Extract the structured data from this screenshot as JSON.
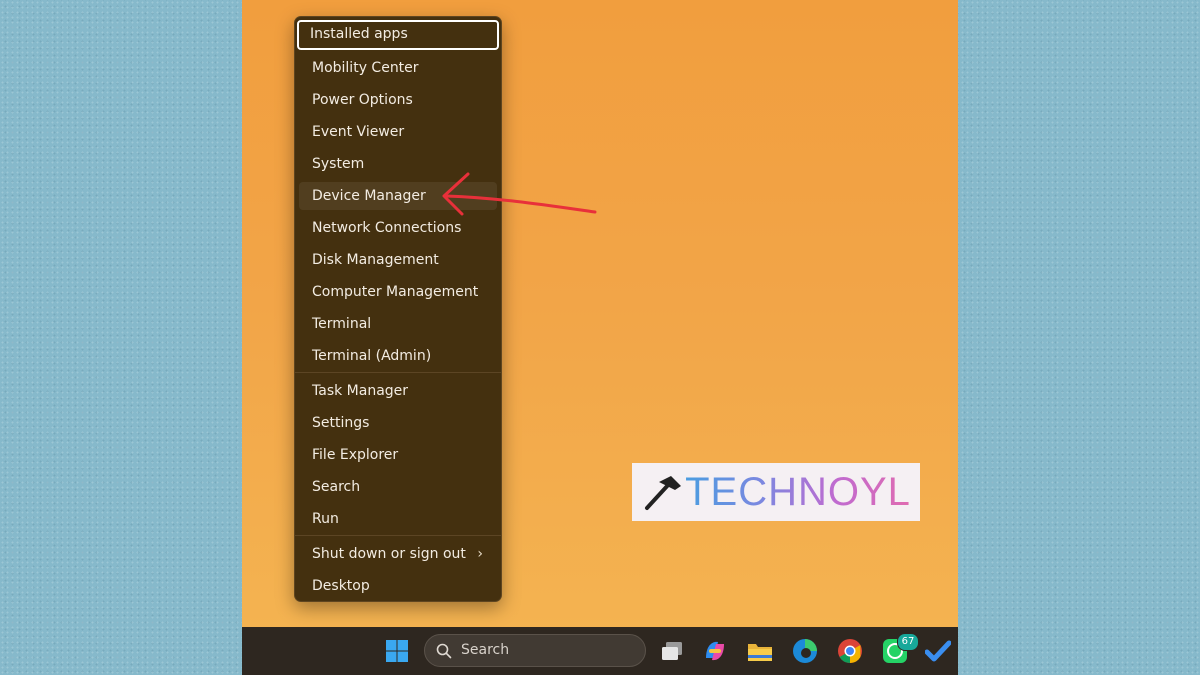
{
  "menu": {
    "items": [
      {
        "label": "Installed apps"
      },
      {
        "label": "Mobility Center"
      },
      {
        "label": "Power Options"
      },
      {
        "label": "Event Viewer"
      },
      {
        "label": "System"
      },
      {
        "label": "Device Manager"
      },
      {
        "label": "Network Connections"
      },
      {
        "label": "Disk Management"
      },
      {
        "label": "Computer Management"
      },
      {
        "label": "Terminal"
      },
      {
        "label": "Terminal (Admin)"
      },
      {
        "label": "Task Manager"
      },
      {
        "label": "Settings"
      },
      {
        "label": "File Explorer"
      },
      {
        "label": "Search"
      },
      {
        "label": "Run"
      },
      {
        "label": "Shut down or sign out"
      },
      {
        "label": "Desktop"
      }
    ]
  },
  "watermark": {
    "text": "TECHNOYL"
  },
  "taskbar": {
    "search_label": "Search",
    "whatsapp_badge": "67",
    "icons": [
      "windows-start-icon",
      "search-icon",
      "task-view-icon",
      "copilot-icon",
      "file-explorer-icon",
      "edge-icon",
      "chrome-icon",
      "whatsapp-icon",
      "todo-icon"
    ]
  },
  "colors": {
    "menu_bg": "#44300f",
    "desktop_top": "#f19e3e",
    "desktop_bottom": "#f4b552",
    "annotation_arrow": "#e8303a",
    "taskbar_bg": "#2e2720"
  }
}
